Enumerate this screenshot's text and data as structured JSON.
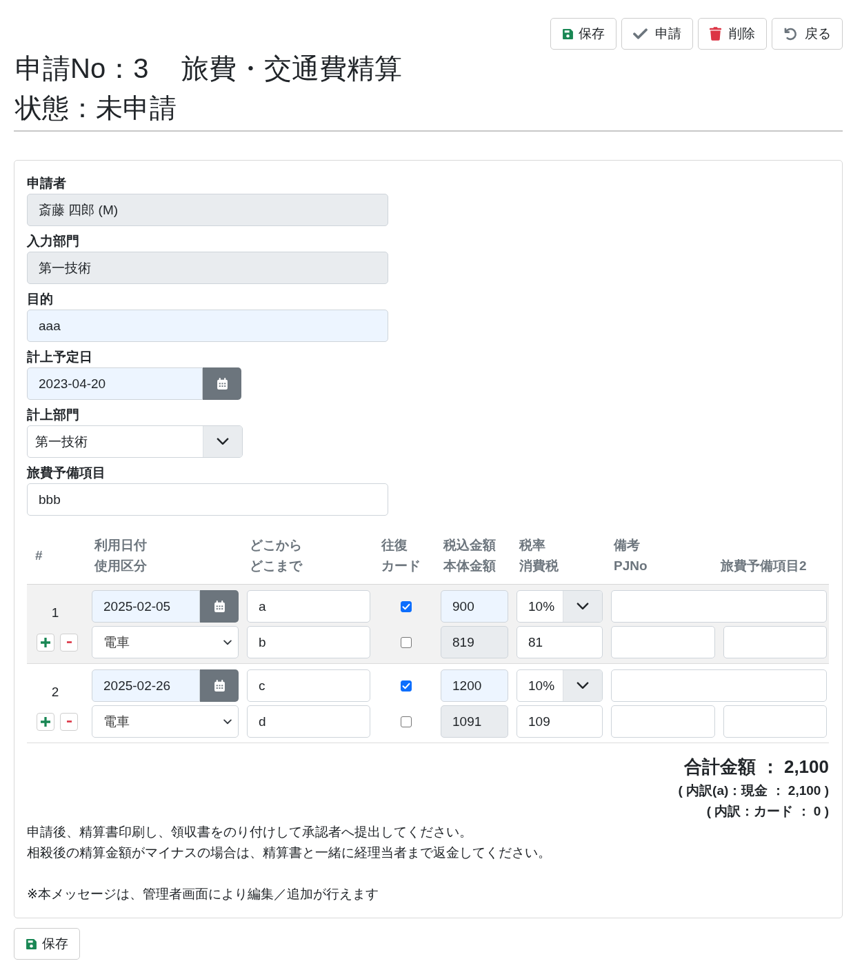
{
  "toolbar": {
    "buttons": [
      {
        "kind": "save",
        "label": "保存"
      },
      {
        "kind": "check",
        "label": "申請"
      },
      {
        "kind": "delete",
        "label": "削除"
      },
      {
        "kind": "back",
        "label": "戻る"
      }
    ]
  },
  "heading": {
    "number": "申請No：3",
    "title": "旅費・交通費精算",
    "status": "状態：未申請"
  },
  "form": {
    "fields": [
      {
        "label": "申請者",
        "kind": "text",
        "value": "斎藤 四郎 (M)",
        "readonly": true,
        "highlighted": false
      },
      {
        "label": "入力部門",
        "kind": "text",
        "value": "第一技術",
        "readonly": true,
        "highlighted": false
      },
      {
        "label": "目的",
        "kind": "text",
        "value": "aaa",
        "readonly": false,
        "highlighted": true
      },
      {
        "label": "計上予定日",
        "kind": "date",
        "value": "2023-04-20",
        "readonly": false,
        "highlighted": true
      },
      {
        "label": "計上部門",
        "kind": "select",
        "value": "第一技術",
        "readonly": false,
        "highlighted": false
      },
      {
        "label": "旅費予備項目",
        "kind": "text",
        "value": "bbb",
        "readonly": false,
        "highlighted": false
      }
    ]
  },
  "table": {
    "columns": [
      {
        "middle": "#"
      },
      {
        "top": "利用日付",
        "bottom": "使用区分"
      },
      {
        "top": "どこから",
        "bottom": "どこまで"
      },
      {
        "top": "往復",
        "bottom": "カード"
      },
      {
        "top": "税込金額",
        "bottom": "本体金額"
      },
      {
        "top": "税率",
        "bottom": "消費税"
      },
      {
        "top": "備考",
        "bottom": "PJNo"
      },
      {
        "bottom": "旅費予備項目2"
      }
    ],
    "rows": [
      {
        "number": "1",
        "date": "2025-02-05",
        "type": "電車",
        "from": "a",
        "to": "b",
        "round_trip": true,
        "card": false,
        "amount_incl": "900",
        "amount_excl": "819",
        "tax_rate": "10%",
        "tax": "81"
      },
      {
        "number": "2",
        "date": "2025-02-26",
        "type": "電車",
        "from": "c",
        "to": "d",
        "round_trip": true,
        "card": false,
        "amount_incl": "1200",
        "amount_excl": "1091",
        "tax_rate": "10%",
        "tax": "109"
      }
    ]
  },
  "totals": {
    "total": "合計金額 ： 2,100",
    "cash": "( 内訳(a)：現金 ： 2,100 )",
    "card": "( 内訳：カード ： 0 )"
  },
  "notes": [
    {
      "lines": [
        "申請後、精算書印刷し、領収書をのり付けして承認者へ提出してください。",
        "相殺後の精算金額がマイナスの場合は、精算書と一緒に経理当者まで返金してください。"
      ]
    },
    {
      "lines": [
        "※本メッセージは、管理者画面により編集／追加が行えます"
      ]
    }
  ],
  "footer": {
    "buttons": [
      {
        "kind": "save",
        "label": "保存"
      }
    ]
  }
}
